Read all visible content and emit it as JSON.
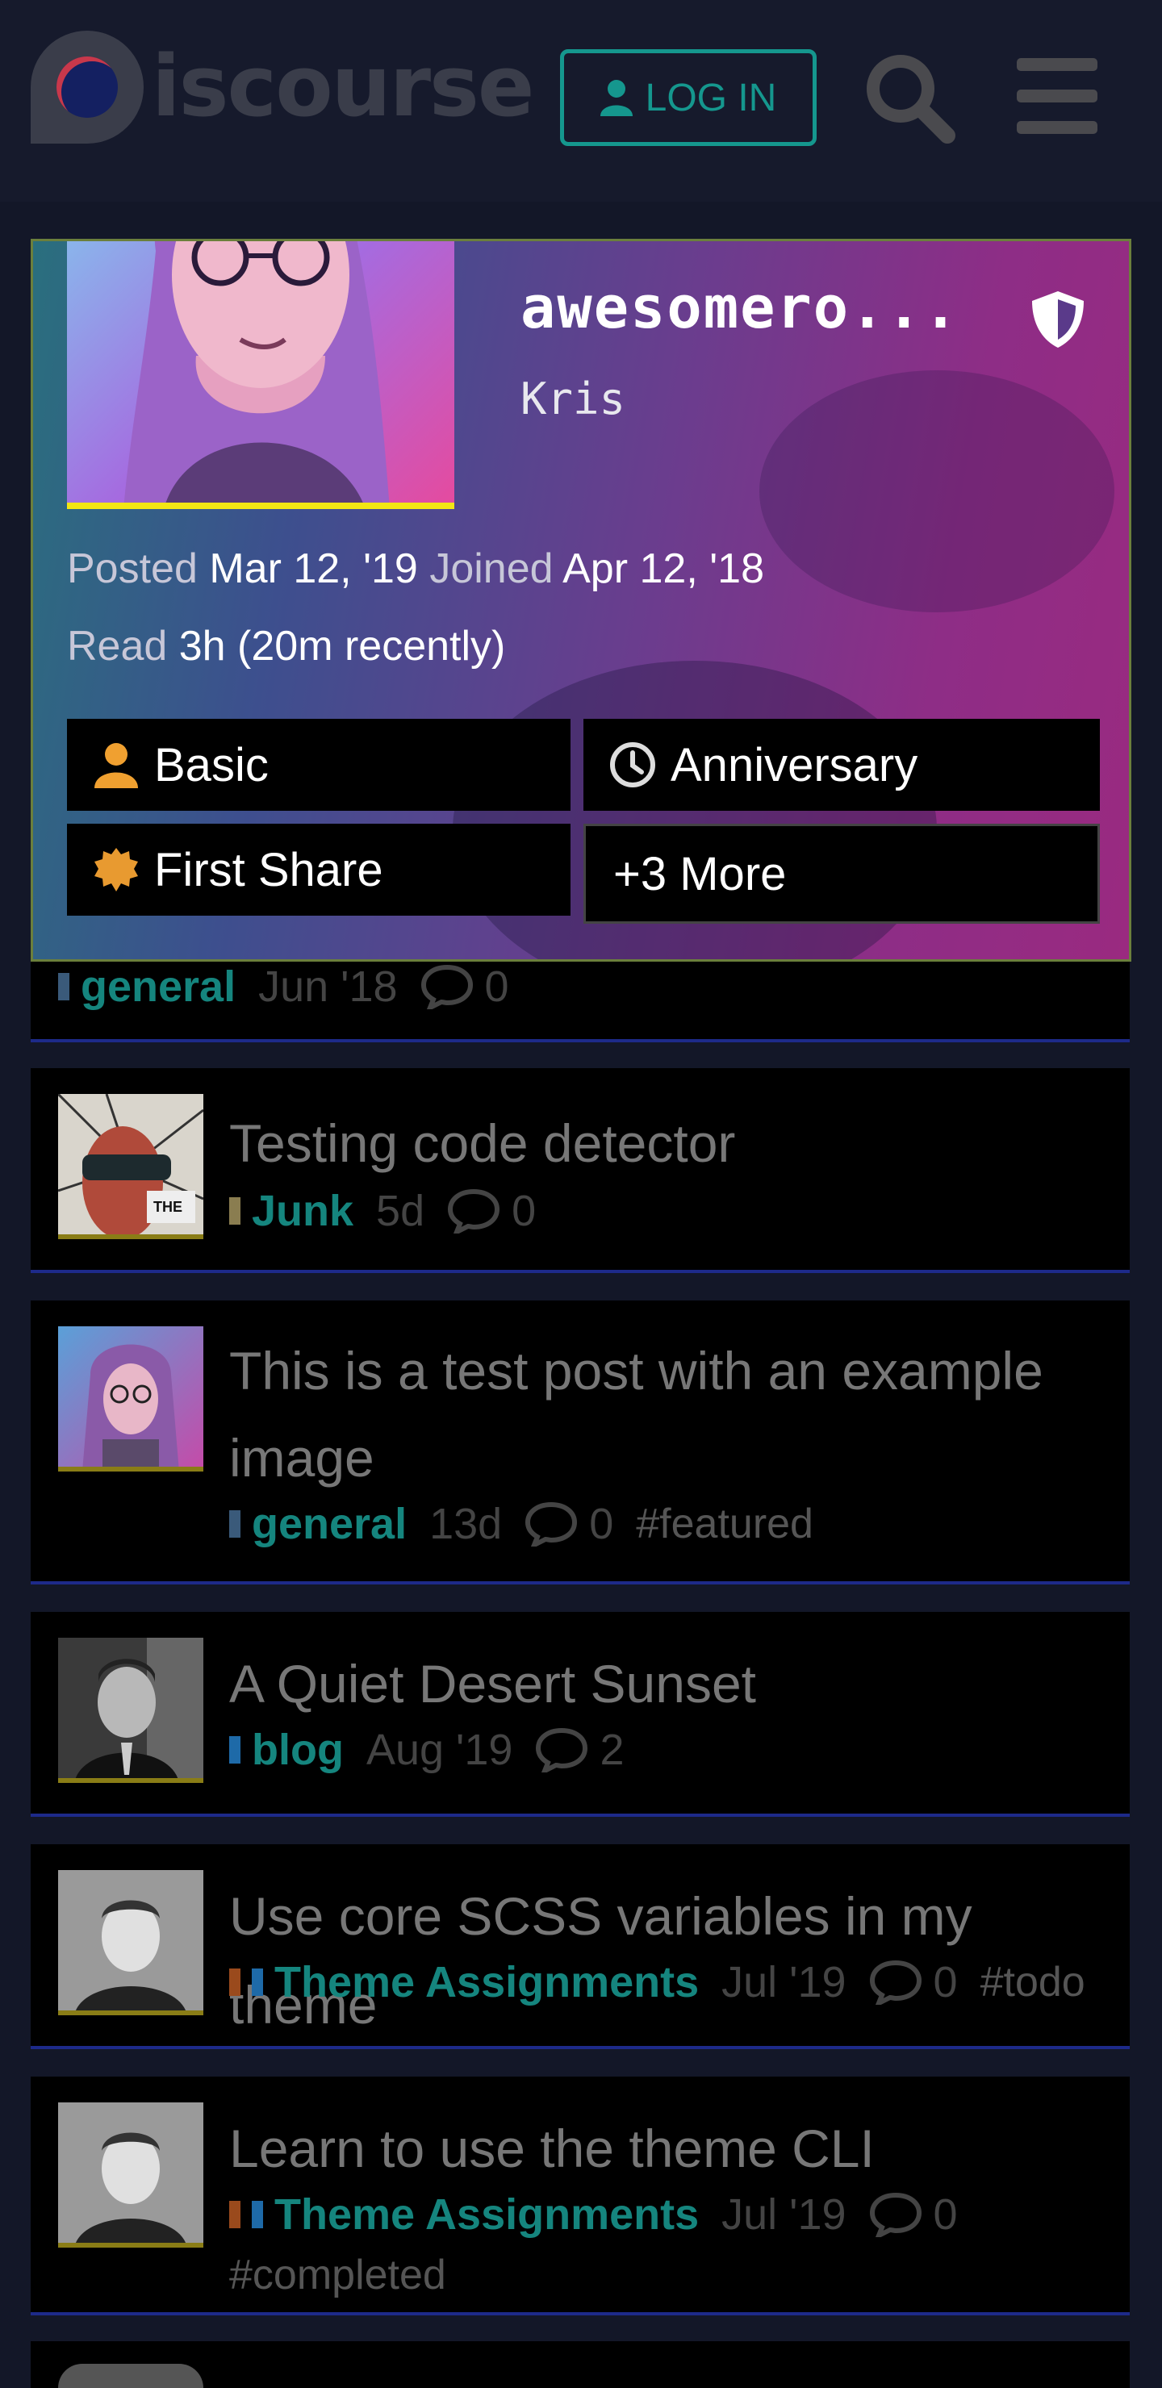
{
  "header": {
    "logo_text": "iscourse",
    "login_label": "LOG IN"
  },
  "profile": {
    "username": "awesomero...",
    "full_name": "Kris",
    "posted_label": "Posted",
    "posted_value": "Mar 12, '19",
    "joined_label": "Joined",
    "joined_value": "Apr 12, '18",
    "read_label": "Read",
    "read_value": "3h (20m recently)",
    "badges": [
      {
        "label": "Basic",
        "icon": "user-icon"
      },
      {
        "label": "Anniversary",
        "icon": "clock-icon"
      },
      {
        "label": "First Share",
        "icon": "certificate-icon"
      },
      {
        "label": "+3 More",
        "icon": ""
      }
    ]
  },
  "partial_topic": {
    "category": "general",
    "date": "Jun '18",
    "replies": "0"
  },
  "topics": [
    {
      "title_lines": [
        "Testing code detector"
      ],
      "category": "Junk",
      "date": "5d",
      "replies": "0",
      "tags": []
    },
    {
      "title_lines": [
        "This is a test post with an example",
        "image"
      ],
      "category": "general",
      "date": "13d",
      "replies": "0",
      "tags": [
        "#featured"
      ]
    },
    {
      "title_lines": [
        "A Quiet Desert Sunset"
      ],
      "category": "blog",
      "date": "Aug '19",
      "replies": "2",
      "tags": []
    },
    {
      "title_lines": [
        "Use core SCSS variables in my theme"
      ],
      "category": "Theme Assignments",
      "date": "Jul '19",
      "replies": "0",
      "tags": [
        "#todo"
      ]
    },
    {
      "title_lines": [
        "Learn to use the theme CLI"
      ],
      "category": "Theme Assignments",
      "date": "Jul '19",
      "replies": "0",
      "tags": [
        "#completed"
      ]
    }
  ],
  "colors": {
    "accent": "#15978e",
    "category_text": "#15857e",
    "avatar_underline": "#f3e614",
    "topic_border": "#1d2a8a"
  }
}
